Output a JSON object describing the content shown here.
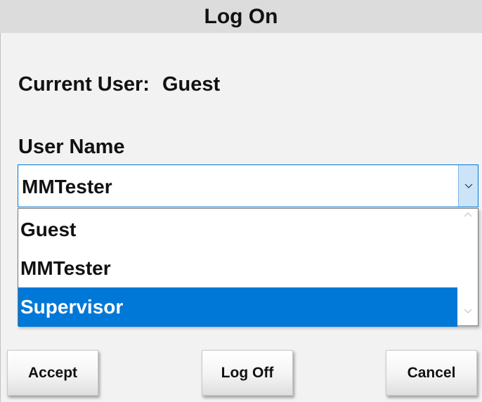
{
  "window": {
    "title": "Log On"
  },
  "current_user": {
    "label": "Current User:",
    "value": "Guest"
  },
  "username": {
    "label": "User Name",
    "selected": "MMTester",
    "options": [
      "Guest",
      "MMTester",
      "Supervisor"
    ],
    "highlighted": "Supervisor"
  },
  "buttons": {
    "accept": "Accept",
    "logoff": "Log Off",
    "cancel": "Cancel"
  },
  "colors": {
    "highlight": "#0078d7",
    "combo_border": "#0078d7",
    "combo_button": "#cce4f7"
  },
  "icons": {
    "dropdown_arrow": "chevron-down-icon",
    "scroll_up": "chevron-up-icon",
    "scroll_down": "chevron-down-icon"
  }
}
